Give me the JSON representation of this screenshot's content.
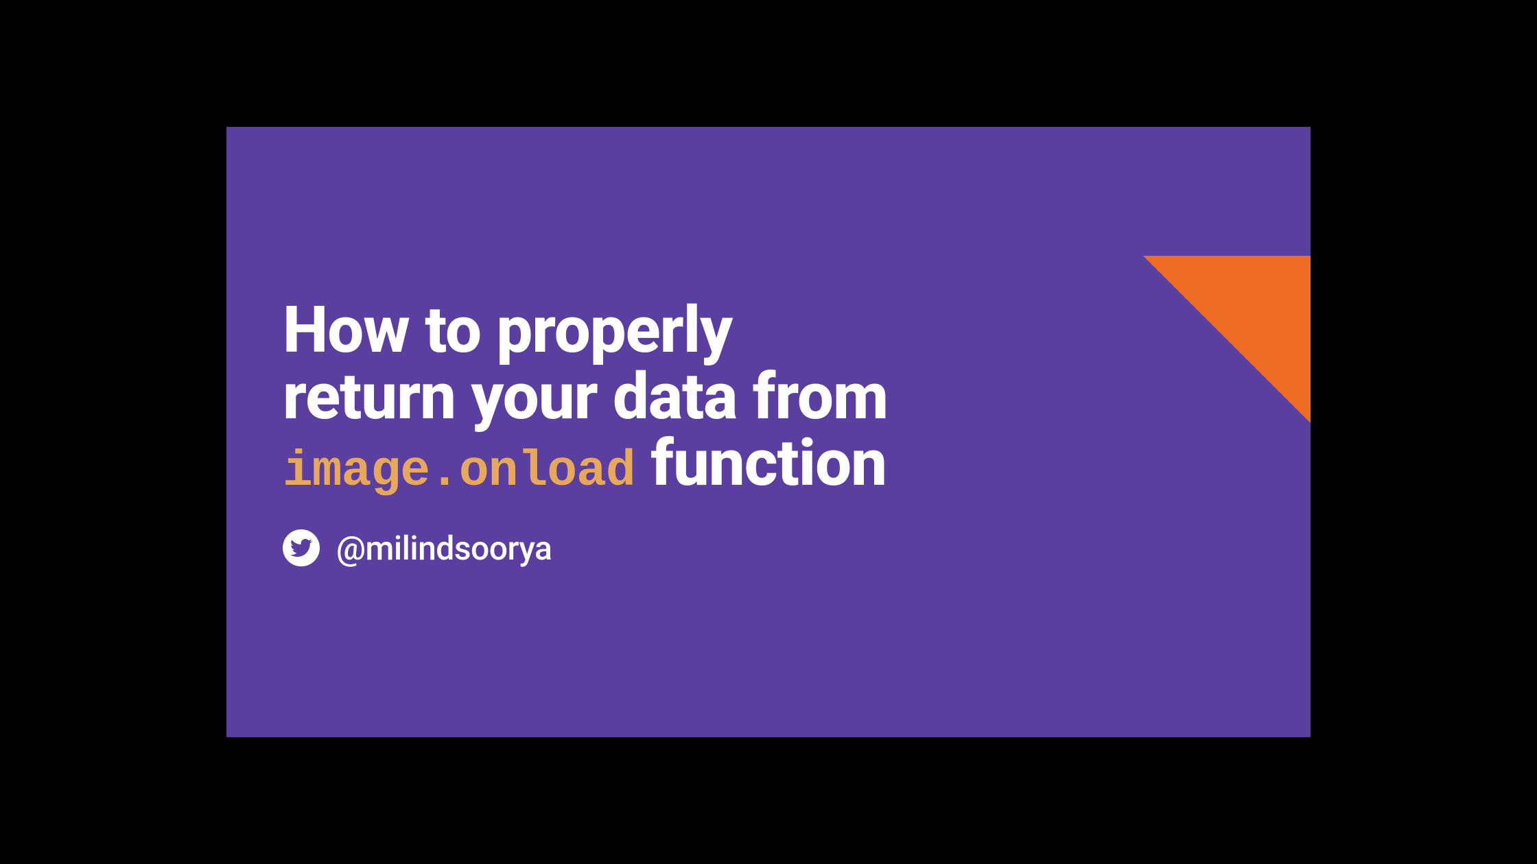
{
  "title": {
    "line1": "How to properly",
    "line2": "return your data from",
    "code": "image.onload",
    "line3_after_code": " function"
  },
  "social": {
    "handle": "@milindsoorya",
    "icon": "twitter-icon"
  },
  "colors": {
    "background": "#5a3fa0",
    "accent_triangle": "#ee6c24",
    "code_text": "#e7a85b",
    "text": "#ffffff"
  }
}
